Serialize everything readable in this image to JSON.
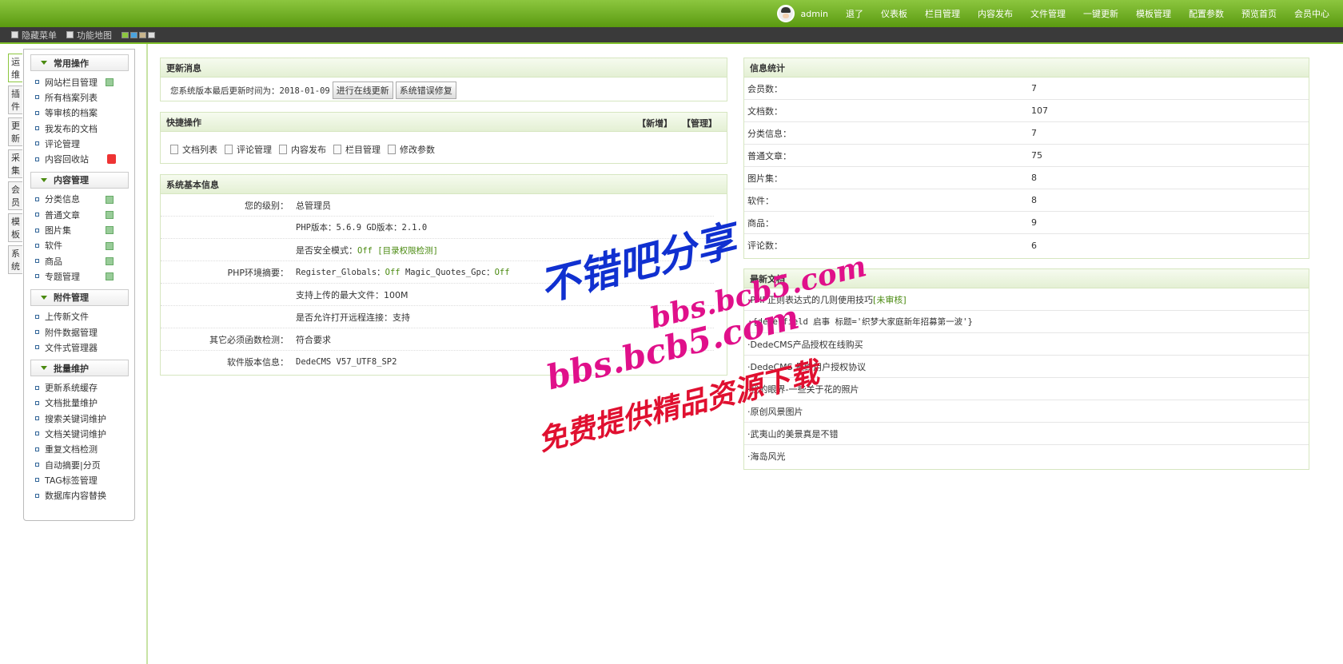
{
  "topnav": {
    "user": "admin",
    "links": [
      "退了",
      "仪表板",
      "栏目管理",
      "内容发布",
      "文件管理",
      "一键更新",
      "模板管理",
      "配置参数",
      "预览首页",
      "会员中心"
    ]
  },
  "subbar": {
    "hide_menu": "隐藏菜单",
    "func_map": "功能地图",
    "swatches": [
      "#8cc63f",
      "#4aa3df",
      "#c8b48c",
      "#dddddd"
    ]
  },
  "sidetabs": [
    "运维",
    "插件",
    "更新",
    "采集",
    "会员",
    "模板",
    "系统"
  ],
  "sidebar": {
    "groups": [
      {
        "title": "常用操作",
        "items": [
          "网站栏目管理",
          "所有档案列表",
          "等审核的档案",
          "我发布的文档",
          "评论管理",
          "内容回收站"
        ]
      },
      {
        "title": "内容管理",
        "items": [
          "分类信息",
          "普通文章",
          "图片集",
          "软件",
          "商品",
          "专题管理"
        ]
      },
      {
        "title": "附件管理",
        "items": [
          "上传新文件",
          "附件数据管理",
          "文件式管理器"
        ]
      },
      {
        "title": "批量维护",
        "items": [
          "更新系统缓存",
          "文档批量维护",
          "搜索关键词维护",
          "文档关键词维护",
          "重复文档检测",
          "自动摘要|分页",
          "TAG标签管理",
          "数据库内容替换"
        ]
      }
    ]
  },
  "update": {
    "title": "更新消息",
    "text": "您系统版本最后更新时间为：2018-01-09",
    "btn_online": "进行在线更新",
    "btn_fix": "系统错误修复"
  },
  "quick": {
    "title": "快捷操作",
    "add": "【新增】",
    "manage": "【管理】",
    "items": [
      "文档列表",
      "评论管理",
      "内容发布",
      "栏目管理",
      "修改参数"
    ]
  },
  "sysinfo": {
    "title": "系统基本信息",
    "level_label": "您的级别：",
    "level_value": "总管理员",
    "env_label": "PHP环境摘要：",
    "php_version": "PHP版本：5.6.9  GD版本：2.1.0",
    "safe_mode_label": "是否安全模式：",
    "safe_mode_value": "Off [目录权限检测]",
    "globals_label": "Register_Globals：",
    "globals_value": "Off",
    "magic_label": " Magic_Quotes_Gpc：",
    "magic_value": "Off",
    "upload": "支持上传的最大文件：100M",
    "remote": "是否允许打开远程连接：支持",
    "func_label": "其它必须函数检测：",
    "func_value": "符合要求",
    "ver_label": "软件版本信息：",
    "ver_value": "DedeCMS V57_UTF8_SP2"
  },
  "stats": {
    "title": "信息统计",
    "rows": [
      {
        "k": "会员数：",
        "v": "7"
      },
      {
        "k": "文档数：",
        "v": "107"
      },
      {
        "k": "分类信息：",
        "v": "7"
      },
      {
        "k": "普通文章：",
        "v": "75"
      },
      {
        "k": "图片集：",
        "v": "8"
      },
      {
        "k": "软件：",
        "v": "8"
      },
      {
        "k": "商品：",
        "v": "9"
      },
      {
        "k": "评论数：",
        "v": "6"
      }
    ]
  },
  "news": {
    "title": "最新文档",
    "items": [
      "·PHP正则表达式的几则使用技巧",
      "·{dede:field 启事  标题='织梦大家庭新年招募第一波'}",
      "·DedeCMS产品授权在线购买",
      "·DedeCMS 最终用户授权协议",
      "·我的眼界-一些关于花的照片",
      "·原创风景图片",
      "·武夷山的美景真是不错",
      "·海岛风光"
    ],
    "pending": "[未审核]"
  },
  "watermark": {
    "line1": "不错吧分享",
    "line2": "bbs.bcb5.com",
    "line3": "bbs.bcb5.com",
    "line4": "免费提供精品资源下载"
  }
}
